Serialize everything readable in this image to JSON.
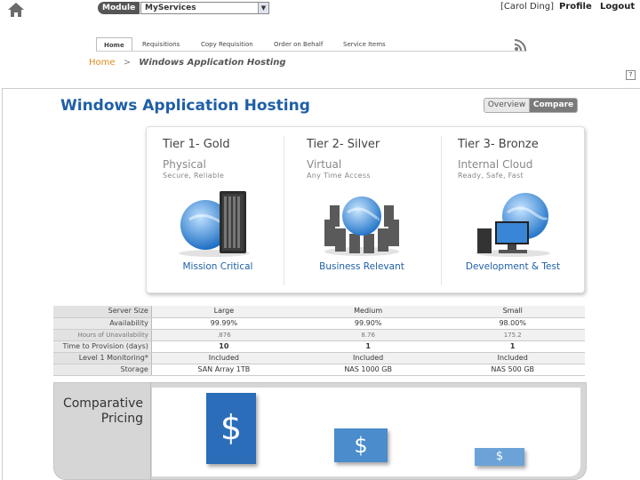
{
  "topbar": {
    "home_icon": "home-icon",
    "module_label": "Module",
    "module_selected": "MyServices",
    "user": "[Carol Ding]",
    "profile": "Profile",
    "logout": "Logout"
  },
  "nav": {
    "tabs": [
      {
        "label": "Home",
        "active": true
      },
      {
        "label": "Requisitions",
        "active": false
      },
      {
        "label": "Copy Requisition",
        "active": false
      },
      {
        "label": "Order on Behalf",
        "active": false
      },
      {
        "label": "Service Items",
        "active": false
      }
    ],
    "rss_icon": "rss-icon"
  },
  "breadcrumb": {
    "home": "Home",
    "separator": ">",
    "current": "Windows Application Hosting"
  },
  "help": "?",
  "page": {
    "title": "Windows Application Hosting",
    "view_toggle": {
      "overview": "Overview",
      "compare": "Compare",
      "selected": "Compare"
    }
  },
  "tiers": [
    {
      "name": "Tier 1- Gold",
      "type": "Physical",
      "subtitle": "Secure, Reliable",
      "label": "Mission Critical",
      "illustration": "server-rack-globe"
    },
    {
      "name": "Tier 2- Silver",
      "type": "Virtual",
      "subtitle": "Any Time Access",
      "label": "Business Relevant",
      "illustration": "servers-around-globe"
    },
    {
      "name": "Tier 3- Bronze",
      "type": "Internal Cloud",
      "subtitle": "Ready, Safe, Fast",
      "label": "Development & Test",
      "illustration": "computer-globe"
    }
  ],
  "spec_rows": [
    {
      "label": "Server Size",
      "values": [
        "Large",
        "Medium",
        "Small"
      ],
      "style": "normal"
    },
    {
      "label": "Availability",
      "values": [
        "99.99%",
        "99.90%",
        "98.00%"
      ],
      "style": "normal"
    },
    {
      "label": "Hours of Unavailability",
      "values": [
        ".876",
        "8.76",
        "175.2"
      ],
      "style": "sub"
    },
    {
      "label": "Time to Provision (days)",
      "values": [
        "10",
        "1",
        "1"
      ],
      "style": "normal"
    },
    {
      "label": "Level 1 Monitoring*",
      "values": [
        "Included",
        "Included",
        "Included"
      ],
      "style": "normal"
    },
    {
      "label": "Storage",
      "values": [
        "SAN Array 1TB",
        "NAS 1000 GB",
        "NAS 500 GB"
      ],
      "style": "normal"
    }
  ],
  "pricing": {
    "label_line1": "Comparative",
    "label_line2": "Pricing",
    "symbols": [
      "$",
      "$",
      "$"
    ]
  }
}
